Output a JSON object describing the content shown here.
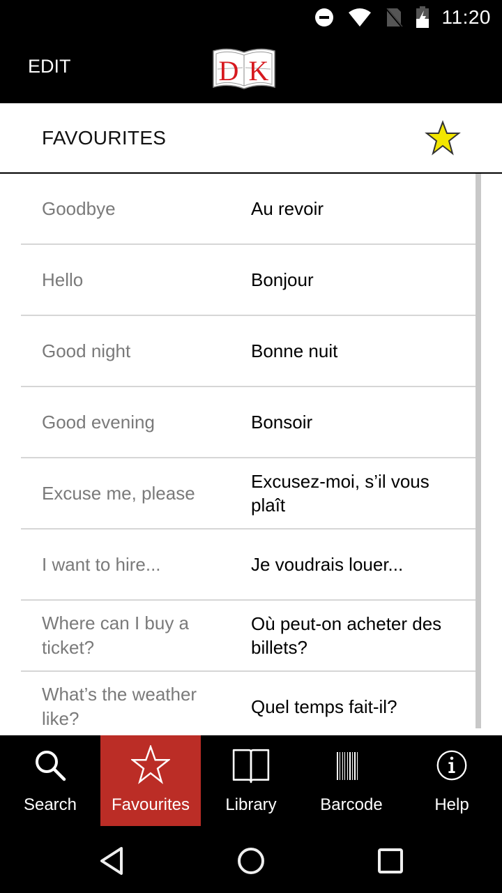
{
  "status_bar": {
    "time": "11:20",
    "icons": [
      "do-not-disturb-icon",
      "wifi-icon",
      "no-sim-icon",
      "battery-charging-icon"
    ]
  },
  "app_bar": {
    "edit_label": "EDIT",
    "logo_text": "DK",
    "colors": {
      "logo_red": "#d7191f"
    }
  },
  "favourites_header": {
    "title": "FAVOURITES",
    "star_color": "#f2e600"
  },
  "phrases": [
    {
      "english": "Goodbye",
      "french": "Au revoir"
    },
    {
      "english": "Hello",
      "french": "Bonjour"
    },
    {
      "english": "Good night",
      "french": "Bonne nuit"
    },
    {
      "english": "Good evening",
      "french": "Bonsoir"
    },
    {
      "english": "Excuse me, please",
      "french": "Excusez-moi, s’il vous plaît"
    },
    {
      "english": "I want to hire...",
      "french": "Je voudrais louer..."
    },
    {
      "english": "Where can I buy a ticket?",
      "french": "Où peut-on acheter des billets?"
    },
    {
      "english": "What’s the weather like?",
      "french": "Quel temps fait-il?"
    }
  ],
  "tabs": [
    {
      "label": "Search",
      "icon": "search-icon",
      "active": false
    },
    {
      "label": "Favourites",
      "icon": "star-icon",
      "active": true
    },
    {
      "label": "Library",
      "icon": "book-icon",
      "active": false
    },
    {
      "label": "Barcode",
      "icon": "barcode-icon",
      "active": false
    },
    {
      "label": "Help",
      "icon": "info-icon",
      "active": false
    }
  ],
  "tab_active_color": "#bb2d26",
  "nav": [
    "back-icon",
    "home-icon",
    "recents-icon"
  ]
}
